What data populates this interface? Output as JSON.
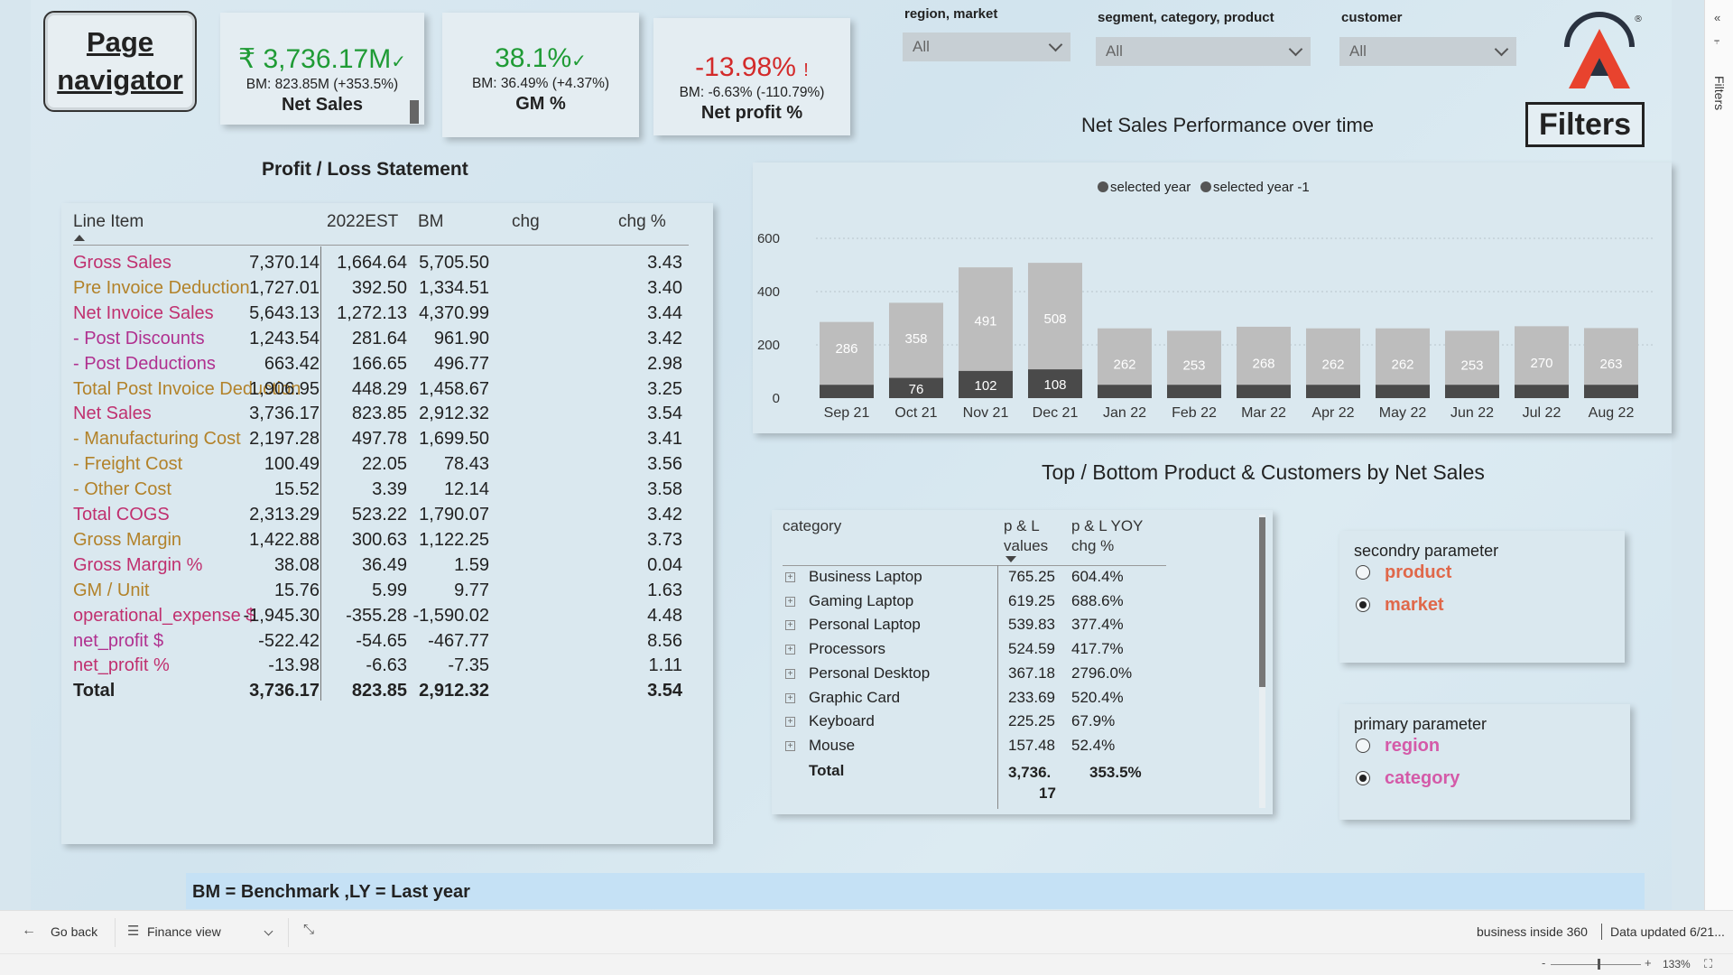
{
  "page_navigator": {
    "label": "Page navigator"
  },
  "kpis": {
    "net_sales": {
      "value": "₹ 3,736.17M",
      "benchmark": "BM: 823.85M (+353.5%)",
      "label": "Net Sales",
      "status_mark": "✓"
    },
    "gm_pct": {
      "value": "38.1%",
      "benchmark": "BM: 36.49% (+4.37%)",
      "label": "GM %",
      "status_mark": "✓"
    },
    "net_profit_pct": {
      "value": "-13.98%",
      "benchmark": "BM: -6.63% (-110.79%)",
      "label": "Net profit %",
      "status_mark": "!"
    }
  },
  "filters": {
    "region_market": {
      "label": "region, market",
      "value": "All"
    },
    "segment_category_product": {
      "label": "segment, category, product",
      "value": "All"
    },
    "customer": {
      "label": "customer",
      "value": "All"
    },
    "filters_button": "Filters",
    "rail_label": "Filters"
  },
  "pl": {
    "title": "Profit / Loss Statement",
    "headers": [
      "Line Item",
      "2022EST",
      "BM",
      "chg",
      "chg %"
    ],
    "rows": [
      {
        "item": "Gross Sales",
        "est": "7,370.14",
        "bm": "1,664.64",
        "chg": "5,705.50",
        "chgp": "3.43",
        "color": "#c0306f"
      },
      {
        "item": "Pre Invoice Deduction",
        "est": "1,727.01",
        "bm": "392.50",
        "chg": "1,334.51",
        "chgp": "3.40",
        "color": "#b2822a"
      },
      {
        "item": "Net Invoice Sales",
        "est": "5,643.13",
        "bm": "1,272.13",
        "chg": "4,370.99",
        "chgp": "3.44",
        "color": "#c0306f"
      },
      {
        "item": "- Post Discounts",
        "est": "1,243.54",
        "bm": "281.64",
        "chg": "961.90",
        "chgp": "3.42",
        "color": "#b0308f"
      },
      {
        "item": "- Post Deductions",
        "est": "663.42",
        "bm": "166.65",
        "chg": "496.77",
        "chgp": "2.98",
        "color": "#b0308f"
      },
      {
        "item": "Total Post Invoice Deduction",
        "est": "1,906.95",
        "bm": "448.29",
        "chg": "1,458.67",
        "chgp": "3.25",
        "color": "#b2822a"
      },
      {
        "item": "Net Sales",
        "est": "3,736.17",
        "bm": "823.85",
        "chg": "2,912.32",
        "chgp": "3.54",
        "color": "#c0306f"
      },
      {
        "item": "- Manufacturing Cost",
        "est": "2,197.28",
        "bm": "497.78",
        "chg": "1,699.50",
        "chgp": "3.41",
        "color": "#b2822a"
      },
      {
        "item": "- Freight Cost",
        "est": "100.49",
        "bm": "22.05",
        "chg": "78.43",
        "chgp": "3.56",
        "color": "#b2822a"
      },
      {
        "item": "- Other Cost",
        "est": "15.52",
        "bm": "3.39",
        "chg": "12.14",
        "chgp": "3.58",
        "color": "#b2822a"
      },
      {
        "item": "Total COGS",
        "est": "2,313.29",
        "bm": "523.22",
        "chg": "1,790.07",
        "chgp": "3.42",
        "color": "#c0306f"
      },
      {
        "item": "Gross Margin",
        "est": "1,422.88",
        "bm": "300.63",
        "chg": "1,122.25",
        "chgp": "3.73",
        "color": "#b2822a"
      },
      {
        "item": "Gross Margin %",
        "est": "38.08",
        "bm": "36.49",
        "chg": "1.59",
        "chgp": "0.04",
        "color": "#c0306f"
      },
      {
        "item": "GM / Unit",
        "est": "15.76",
        "bm": "5.99",
        "chg": "9.77",
        "chgp": "1.63",
        "color": "#b2822a"
      },
      {
        "item": "operational_expense $",
        "est": "-1,945.30",
        "bm": "-355.28",
        "chg": "-1,590.02",
        "chgp": "4.48",
        "color": "#c0306f"
      },
      {
        "item": "net_profit $",
        "est": "-522.42",
        "bm": "-54.65",
        "chg": "-467.77",
        "chgp": "8.56",
        "color": "#b0308f"
      },
      {
        "item": "net_profit %",
        "est": "-13.98",
        "bm": "-6.63",
        "chg": "-7.35",
        "chgp": "1.11",
        "color": "#c0306f"
      }
    ],
    "total": {
      "item": "Total",
      "est": "3,736.17",
      "bm": "823.85",
      "chg": "2,912.32",
      "chgp": "3.54"
    }
  },
  "chart_title": "Net Sales  Performance over time",
  "chart_data": {
    "type": "bar",
    "legend": [
      "selected year",
      "selected year -1"
    ],
    "legend_position": "top-center",
    "categories": [
      "Sep 21",
      "Oct 21",
      "Nov 21",
      "Dec 21",
      "Jan 22",
      "Feb 22",
      "Mar 22",
      "Apr 22",
      "May 22",
      "Jun 22",
      "Jul 22",
      "Aug 22"
    ],
    "series": [
      {
        "name": "selected year",
        "values": [
          286,
          358,
          491,
          508,
          262,
          253,
          268,
          262,
          262,
          253,
          270,
          263
        ],
        "color": "#bdbdbd"
      },
      {
        "name": "selected year -1",
        "values": [
          50,
          76,
          102,
          108,
          50,
          50,
          50,
          50,
          50,
          50,
          50,
          50
        ],
        "color": "#4a4a4a"
      }
    ],
    "data_labels_selected_year": [
      "286",
      "358",
      "491",
      "508",
      "262",
      "253",
      "268",
      "262",
      "262",
      "253",
      "270",
      "263"
    ],
    "data_labels_selected_year_minus_1": [
      "",
      "76",
      "102",
      "108",
      "",
      "",
      "",
      "",
      "",
      "",
      "",
      ""
    ],
    "y_ticks": [
      "0",
      "200",
      "400",
      "600"
    ],
    "ylim": [
      0,
      620
    ],
    "grid": true
  },
  "topbottom": {
    "title": "Top / Bottom Product & Customers by Net Sales",
    "headers": {
      "category": "category",
      "values_1": "p & L",
      "values_2": "values",
      "yoy_1": "p & L YOY",
      "yoy_2": "chg %"
    },
    "rows": [
      {
        "name": "Business Laptop",
        "value": "765.25",
        "yoy": "604.4%"
      },
      {
        "name": "Gaming Laptop",
        "value": "619.25",
        "yoy": "688.6%"
      },
      {
        "name": "Personal Laptop",
        "value": "539.83",
        "yoy": "377.4%"
      },
      {
        "name": "Processors",
        "value": "524.59",
        "yoy": "417.7%"
      },
      {
        "name": "Personal Desktop",
        "value": "367.18",
        "yoy": "2796.0%"
      },
      {
        "name": "Graphic Card",
        "value": "233.69",
        "yoy": "520.4%"
      },
      {
        "name": "Keyboard",
        "value": "225.25",
        "yoy": "67.9%"
      },
      {
        "name": "Mouse",
        "value": "157.48",
        "yoy": "52.4%"
      }
    ],
    "total": {
      "name": "Total",
      "value_1": "3,736.",
      "value_2": "17",
      "yoy": "353.5%"
    }
  },
  "secondary_param": {
    "title": "secondry parameter",
    "options": [
      {
        "label": "product",
        "selected": false
      },
      {
        "label": "market",
        "selected": true
      }
    ],
    "color": "#e0684a"
  },
  "primary_param": {
    "title": "primary parameter",
    "options": [
      {
        "label": "region",
        "selected": false
      },
      {
        "label": "category",
        "selected": true
      }
    ],
    "color": "#d45aa8"
  },
  "banner": "BM = Benchmark ,LY = Last year",
  "footer": {
    "go_back": "Go back",
    "page_select": "Finance view",
    "workspace": "business inside 360",
    "updated": "Data updated 6/21...",
    "zoom": "133%",
    "zoom_minus": "-",
    "zoom_plus": "+"
  }
}
